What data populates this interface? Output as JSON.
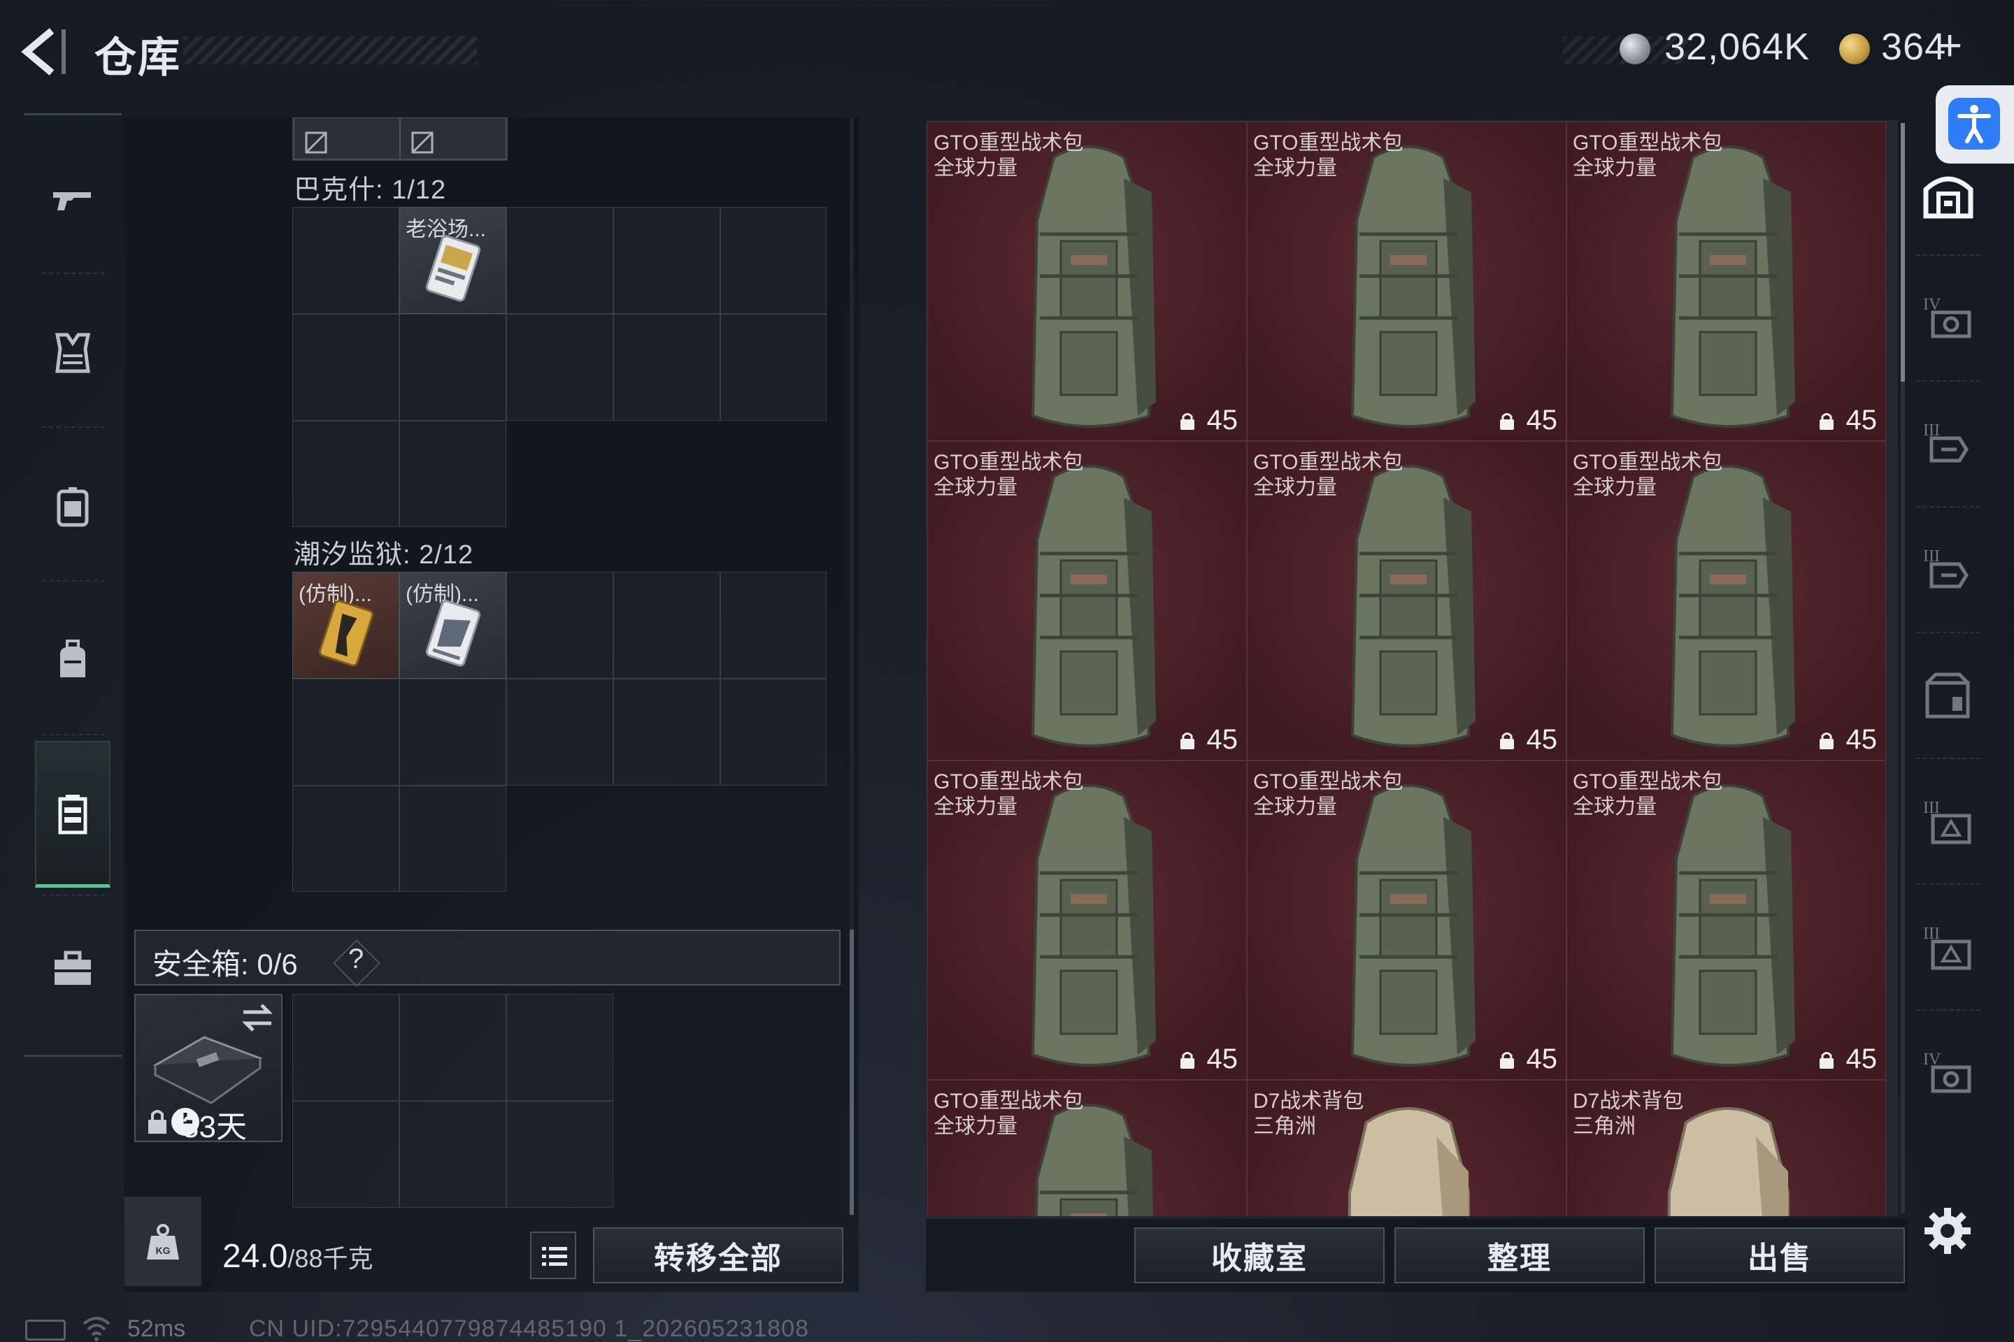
{
  "header": {
    "title": "仓库",
    "currency1": "32,064K",
    "currency2": "364",
    "currency2_plus": "+"
  },
  "stash": {
    "partial_top": {
      "icons": [
        "image-unavailable-icon",
        "image-unavailable-icon"
      ]
    },
    "bakersfield": {
      "label": "巴克什: 1/12",
      "items": [
        {
          "name": "老浴场..."
        }
      ]
    },
    "tide_prison": {
      "label": "潮汐监狱: 2/12",
      "items": [
        {
          "name": "(仿制)..."
        },
        {
          "name": "(仿制)..."
        }
      ]
    },
    "safebox": {
      "label": "安全箱: 0/6",
      "help": "?",
      "days": "33天"
    }
  },
  "bottom": {
    "weight_value": "24.0",
    "weight_cap": "/88千克",
    "transfer_all": "转移全部",
    "collection": "收藏室",
    "organize": "整理",
    "sell": "出售"
  },
  "items": [
    {
      "name": "GTO重型战术包",
      "sub": "全球力量",
      "cap": "45"
    },
    {
      "name": "GTO重型战术包",
      "sub": "全球力量",
      "cap": "45"
    },
    {
      "name": "GTO重型战术包",
      "sub": "全球力量",
      "cap": "45"
    },
    {
      "name": "GTO重型战术包",
      "sub": "全球力量",
      "cap": "45"
    },
    {
      "name": "GTO重型战术包",
      "sub": "全球力量",
      "cap": "45"
    },
    {
      "name": "GTO重型战术包",
      "sub": "全球力量",
      "cap": "45"
    },
    {
      "name": "GTO重型战术包",
      "sub": "全球力量",
      "cap": "45"
    },
    {
      "name": "GTO重型战术包",
      "sub": "全球力量",
      "cap": "45"
    },
    {
      "name": "GTO重型战术包",
      "sub": "全球力量",
      "cap": "45"
    },
    {
      "name": "GTO重型战术包",
      "sub": "全球力量",
      "cap": ""
    },
    {
      "name": "D7战术背包",
      "sub": "三角洲",
      "cap": ""
    },
    {
      "name": "D7战术背包",
      "sub": "三角洲",
      "cap": ""
    }
  ],
  "nav": [
    "weapon-icon",
    "armor-icon",
    "chest-rig-icon",
    "backpack-icon",
    "container-icon",
    "toolbox-icon"
  ],
  "right_tabs": [
    "warehouse-icon",
    "tier-iv-armor-icon",
    "tier-iii-rig-icon",
    "tier-iii-rig-icon",
    "storage-icon",
    "tier-iii-bag-icon",
    "tier-iii-bag-icon",
    "tier-iv-armor-icon"
  ],
  "status": {
    "ping": "52ms",
    "uid": "CN UID:7295440779874485190 1_202605231808"
  },
  "colors": {
    "item_bg": "#4a2228",
    "accent_green": "#4fd08a",
    "accessibility_blue": "#2f7df6"
  }
}
